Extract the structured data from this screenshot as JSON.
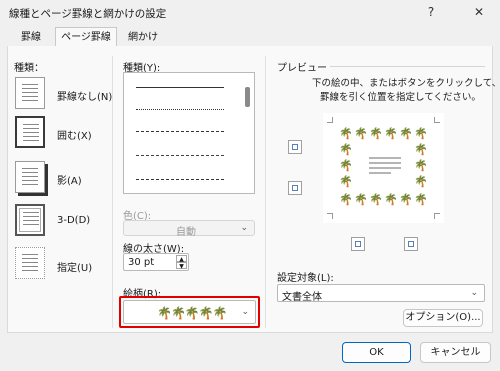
{
  "window": {
    "title": "線種とページ罫線と網かけの設定",
    "help": "?",
    "close": "✕"
  },
  "tabs": [
    "罫線",
    "ページ罫線",
    "網かけ"
  ],
  "types": {
    "heading": "種類：",
    "items": [
      "罫線なし(N)",
      "囲む(X)",
      "影(A)",
      "3-D(D)",
      "指定(U)"
    ]
  },
  "style": {
    "heading": "種類(Y):"
  },
  "color": {
    "label": "色(C):",
    "value": "自動"
  },
  "width": {
    "label": "線の太さ(W):",
    "value": "30 pt"
  },
  "art": {
    "label": "絵柄(R):"
  },
  "preview": {
    "heading": "プレビュー",
    "instruction_line1": "下の絵の中、またはボタンをクリックして、",
    "instruction_line2": "罫線を引く位置を指定してください。"
  },
  "apply": {
    "label": "設定対象(L):",
    "value": "文書全体"
  },
  "buttons": {
    "options": "オプション(O)...",
    "ok": "OK",
    "cancel": "キャンセル"
  },
  "icons": {
    "palm": "🌴",
    "chevron": "⌄",
    "spin_up": "▲",
    "spin_down": "▼"
  },
  "colors": {
    "highlight": "#e00000",
    "accent": "#0067c0"
  }
}
